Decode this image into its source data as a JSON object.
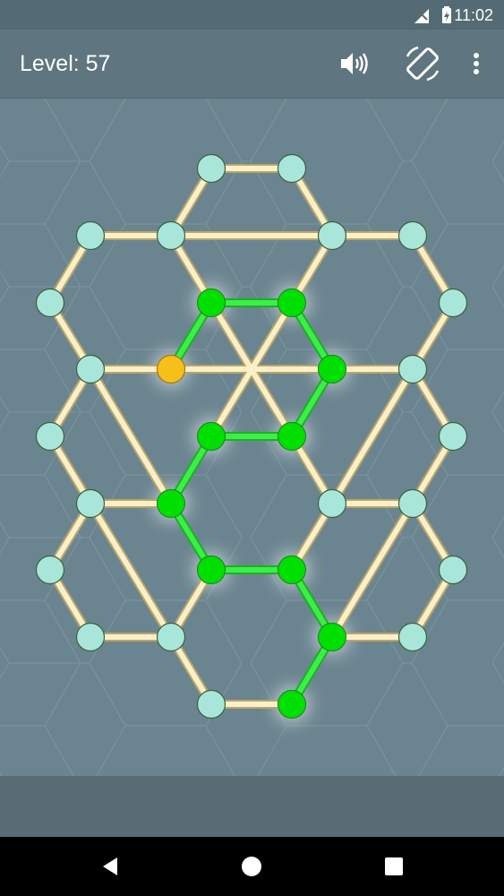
{
  "status_bar": {
    "time": "11:02",
    "icons": [
      "no-signal-icon",
      "battery-charging-icon"
    ]
  },
  "app_bar": {
    "level_label": "Level: 57",
    "actions": [
      "sound-icon",
      "rotate-screen-icon",
      "more-vert-icon"
    ]
  },
  "puzzle": {
    "colors": {
      "edge": "#fdf0c8",
      "edge_outline": "#b8a56c",
      "node": "#a9e6da",
      "node_border": "#3d5f3e",
      "path": "#2ee33a",
      "path_node": "#00e000",
      "start_node": "#f7bf1a",
      "grid_line": "#7d959f"
    }
  },
  "nav_bar": {
    "buttons": [
      "back-icon",
      "home-icon",
      "recents-icon"
    ]
  }
}
